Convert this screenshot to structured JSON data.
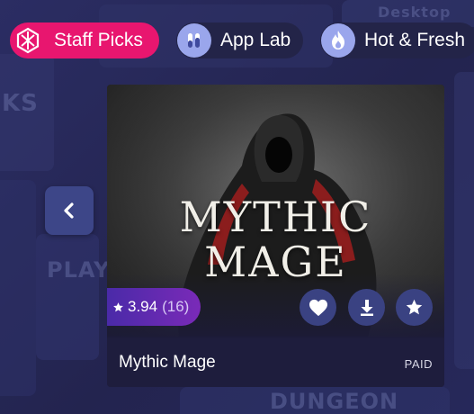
{
  "chips": [
    {
      "label": "Staff Picks",
      "icon": "hexagon-logo-icon",
      "active": true
    },
    {
      "label": "App Lab",
      "icon": "test-tubes-icon",
      "active": false
    },
    {
      "label": "Hot & Fresh",
      "icon": "flame-icon",
      "active": false
    }
  ],
  "background": {
    "word_left": "KS",
    "word_right": "Desktop",
    "word_right_2": "PLAY",
    "word_bottom": "DUNGEON"
  },
  "card": {
    "art_title_line1": "MYTHIC",
    "art_title_line2": "MAGE",
    "rating_value": "3.94",
    "rating_count": "(16)",
    "title": "Mythic Mage",
    "price": "PAID"
  },
  "colors": {
    "accent": "#e8166f",
    "chip_inactive": "#232448",
    "chip_icon": "#9aa6ec",
    "rating_gradient_start": "#4a2aa8",
    "rating_gradient_end": "#7a2ab8",
    "action_button": "#3a4282",
    "nav_button": "#3d4688"
  }
}
